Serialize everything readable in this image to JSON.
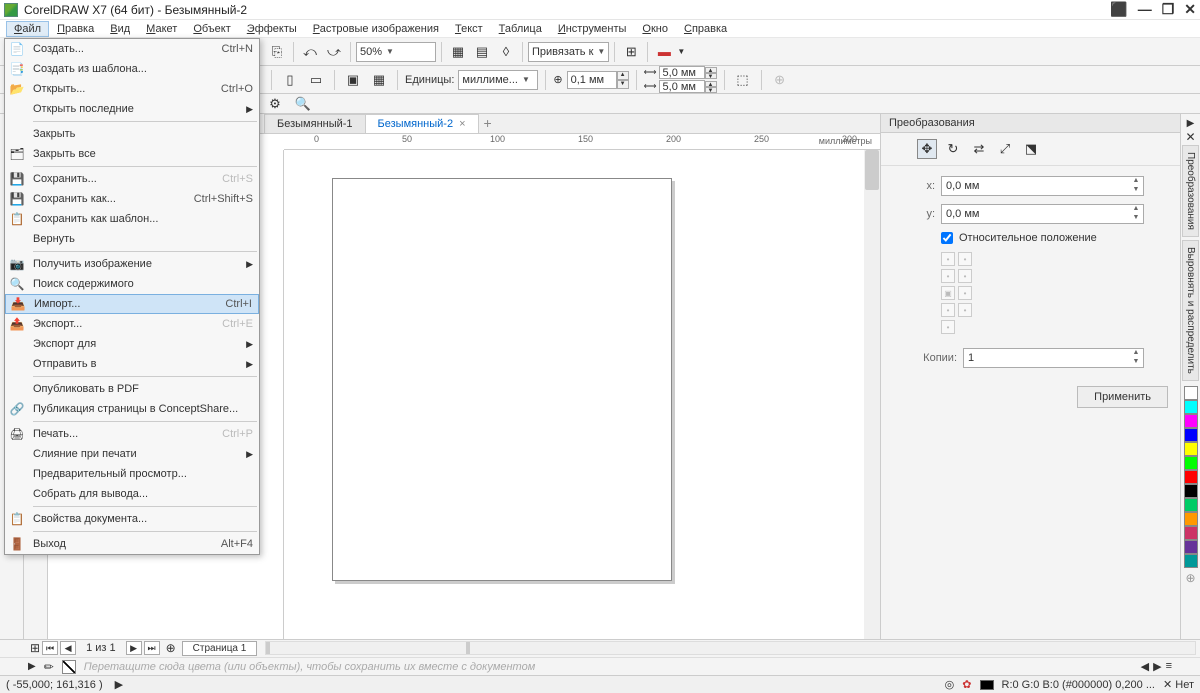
{
  "title": "CorelDRAW X7 (64 бит) - Безымянный-2",
  "menu": [
    "Файл",
    "Правка",
    "Вид",
    "Макет",
    "Объект",
    "Эффекты",
    "Растровые изображения",
    "Текст",
    "Таблица",
    "Инструменты",
    "Окно",
    "Справка"
  ],
  "menu_ul": [
    0,
    0,
    0,
    0,
    0,
    0,
    0,
    0,
    0,
    0,
    0,
    0
  ],
  "file_menu": [
    {
      "icon": "📄",
      "label": "Создать...",
      "sc": "Ctrl+N"
    },
    {
      "icon": "📑",
      "label": "Создать из шаблона..."
    },
    {
      "icon": "📂",
      "label": "Открыть...",
      "sc": "Ctrl+O"
    },
    {
      "icon": "",
      "label": "Открыть последние",
      "sub": true
    },
    {
      "sep": true
    },
    {
      "icon": "",
      "label": "Закрыть"
    },
    {
      "icon": "🗂",
      "label": "Закрыть все"
    },
    {
      "sep": true
    },
    {
      "icon": "💾",
      "label": "Сохранить...",
      "sc": "Ctrl+S",
      "disabled": true
    },
    {
      "icon": "💾",
      "label": "Сохранить как...",
      "sc": "Ctrl+Shift+S"
    },
    {
      "icon": "📋",
      "label": "Сохранить как шаблон..."
    },
    {
      "icon": "",
      "label": "Вернуть",
      "disabled": true
    },
    {
      "sep": true
    },
    {
      "icon": "📷",
      "label": "Получить изображение",
      "sub": true
    },
    {
      "icon": "🔍",
      "label": "Поиск содержимого"
    },
    {
      "icon": "📥",
      "label": "Импорт...",
      "sc": "Ctrl+I",
      "hl": true
    },
    {
      "icon": "📤",
      "label": "Экспорт...",
      "sc": "Ctrl+E",
      "disabled": true
    },
    {
      "icon": "",
      "label": "Экспорт для",
      "sub": true
    },
    {
      "icon": "",
      "label": "Отправить в",
      "sub": true
    },
    {
      "sep": true
    },
    {
      "icon": "",
      "label": "Опубликовать в PDF",
      "disabled": true
    },
    {
      "icon": "🔗",
      "label": "Публикация страницы в ConceptShare..."
    },
    {
      "sep": true
    },
    {
      "icon": "🖨",
      "label": "Печать...",
      "sc": "Ctrl+P",
      "disabled": true
    },
    {
      "icon": "",
      "label": "Слияние при печати",
      "sub": true
    },
    {
      "icon": "",
      "label": "Предварительный просмотр...",
      "disabled": true
    },
    {
      "icon": "",
      "label": "Собрать для вывода...",
      "disabled": true
    },
    {
      "sep": true
    },
    {
      "icon": "📋",
      "label": "Свойства документа..."
    },
    {
      "sep": true
    },
    {
      "icon": "🚪",
      "label": "Выход",
      "sc": "Alt+F4"
    }
  ],
  "zoom": "50%",
  "snap_label": "Привязать к",
  "units_label": "Единицы:",
  "units_value": "миллиме...",
  "nudge": "0,1 мм",
  "dupx": "5,0 мм",
  "dupy": "5,0 мм",
  "tabs": [
    {
      "label": "Безымянный-1"
    },
    {
      "label": "Безымянный-2",
      "active": true
    }
  ],
  "ruler": {
    "ticks": [
      0,
      50,
      100,
      150,
      200,
      250,
      300
    ],
    "unit": "миллиметры"
  },
  "panel": {
    "title": "Преобразования",
    "x_label": "x:",
    "x": "0,0 мм",
    "y_label": "y:",
    "y": "0,0 мм",
    "rel": "Относительное положение",
    "copies_label": "Копии:",
    "copies": "1",
    "apply": "Применить"
  },
  "side_tabs": [
    "Преобразования",
    "Выровнять и распределить"
  ],
  "swatches": [
    "#ffffff",
    "#00ffff",
    "#ff00ff",
    "#0000ff",
    "#ffff00",
    "#00ff00",
    "#ff0000",
    "#000000",
    "#00cc66",
    "#ff9900",
    "#cc3366",
    "#663399",
    "#009999"
  ],
  "pagenav": {
    "pos": "1 из 1",
    "page": "Страница 1"
  },
  "hint": "Перетащите сюда цвета (или объекты), чтобы сохранить их вместе с документом",
  "status": {
    "coords": "( -55,000; 161,316 )",
    "fill": "R:0 G:0 B:0 (#000000)  0,200 ...",
    "none": "Нет"
  },
  "vtext": "миллиметры"
}
